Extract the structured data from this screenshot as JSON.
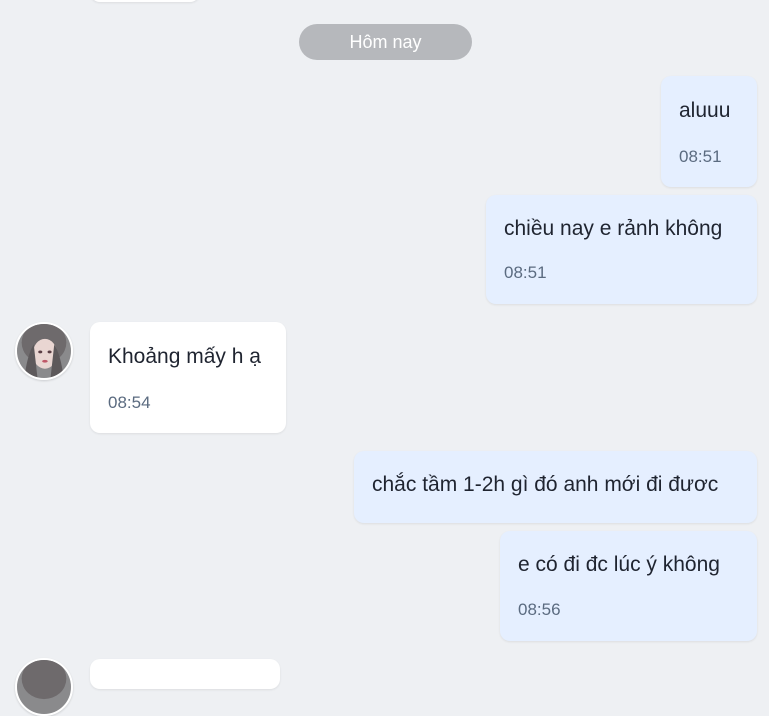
{
  "date_separator": "Hôm nay",
  "messages": [
    {
      "direction": "out",
      "text": "aluuu",
      "time": "08:51"
    },
    {
      "direction": "out",
      "text": "chiều nay e rảnh không",
      "time": "08:51"
    },
    {
      "direction": "in",
      "text": "Khoảng mấy h ạ",
      "time": "08:54"
    },
    {
      "direction": "out",
      "text": "chắc tầm 1-2h gì đó anh mới đi đươc",
      "time": ""
    },
    {
      "direction": "out",
      "text": "e có đi đc lúc ý không",
      "time": "08:56"
    }
  ],
  "colors": {
    "background": "#eef0f3",
    "outgoing_bubble": "#e5efff",
    "incoming_bubble": "#ffffff",
    "date_pill": "#b6b8bc",
    "time_text": "#5b6b80"
  },
  "icons": {
    "contact_avatar": "contact-avatar-image"
  }
}
